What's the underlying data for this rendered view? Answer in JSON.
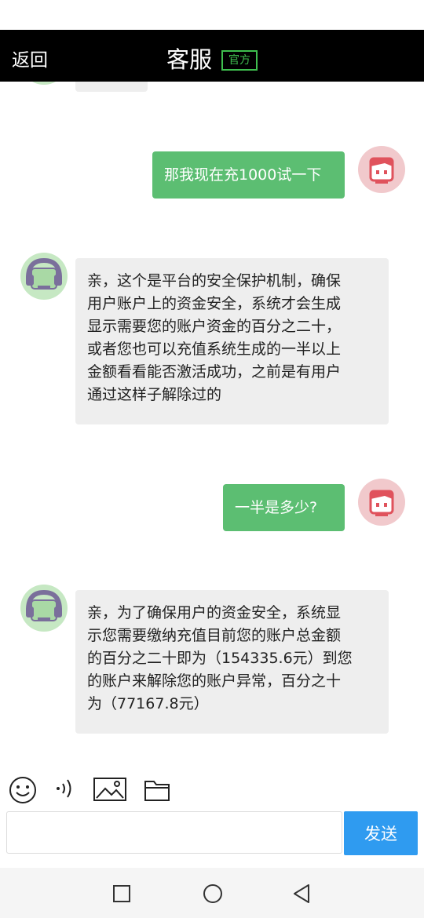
{
  "header": {
    "back_label": "返回",
    "title": "客服",
    "badge": "官方"
  },
  "messages": [
    {
      "sender": "user",
      "text": "那我现在充1000试一下"
    },
    {
      "sender": "agent",
      "lines": [
        "亲，这个是平台的安全保护机制，确保",
        "用户账户上的资金安全，系统才会生成",
        "显示需要您的账户资金的百分之二十，",
        "或者您也可以充值系统生成的一半以上",
        "金额看看能否激活成功，之前是有用户",
        "通过这样子解除过的"
      ]
    },
    {
      "sender": "user",
      "text": "一半是多少?"
    },
    {
      "sender": "agent",
      "lines": [
        "亲，为了确保用户的资金安全，系统显",
        "示您需要缴纳充值目前您的账户总金额",
        "的百分之二十即为（154335.6元）到您",
        "的账户来解除您的账户异常，百分之十",
        "为（77167.8元）"
      ]
    }
  ],
  "toolbar": {
    "icons": [
      "emoji-icon",
      "voice-icon",
      "image-icon",
      "folder-icon"
    ]
  },
  "composer": {
    "value": "",
    "send_label": "发送"
  },
  "colors": {
    "header_bg": "#000000",
    "badge": "#3fbf4f",
    "user_bubble": "#5cbe72",
    "agent_bubble": "#eeeeee",
    "send_button": "#2f9bf0"
  }
}
